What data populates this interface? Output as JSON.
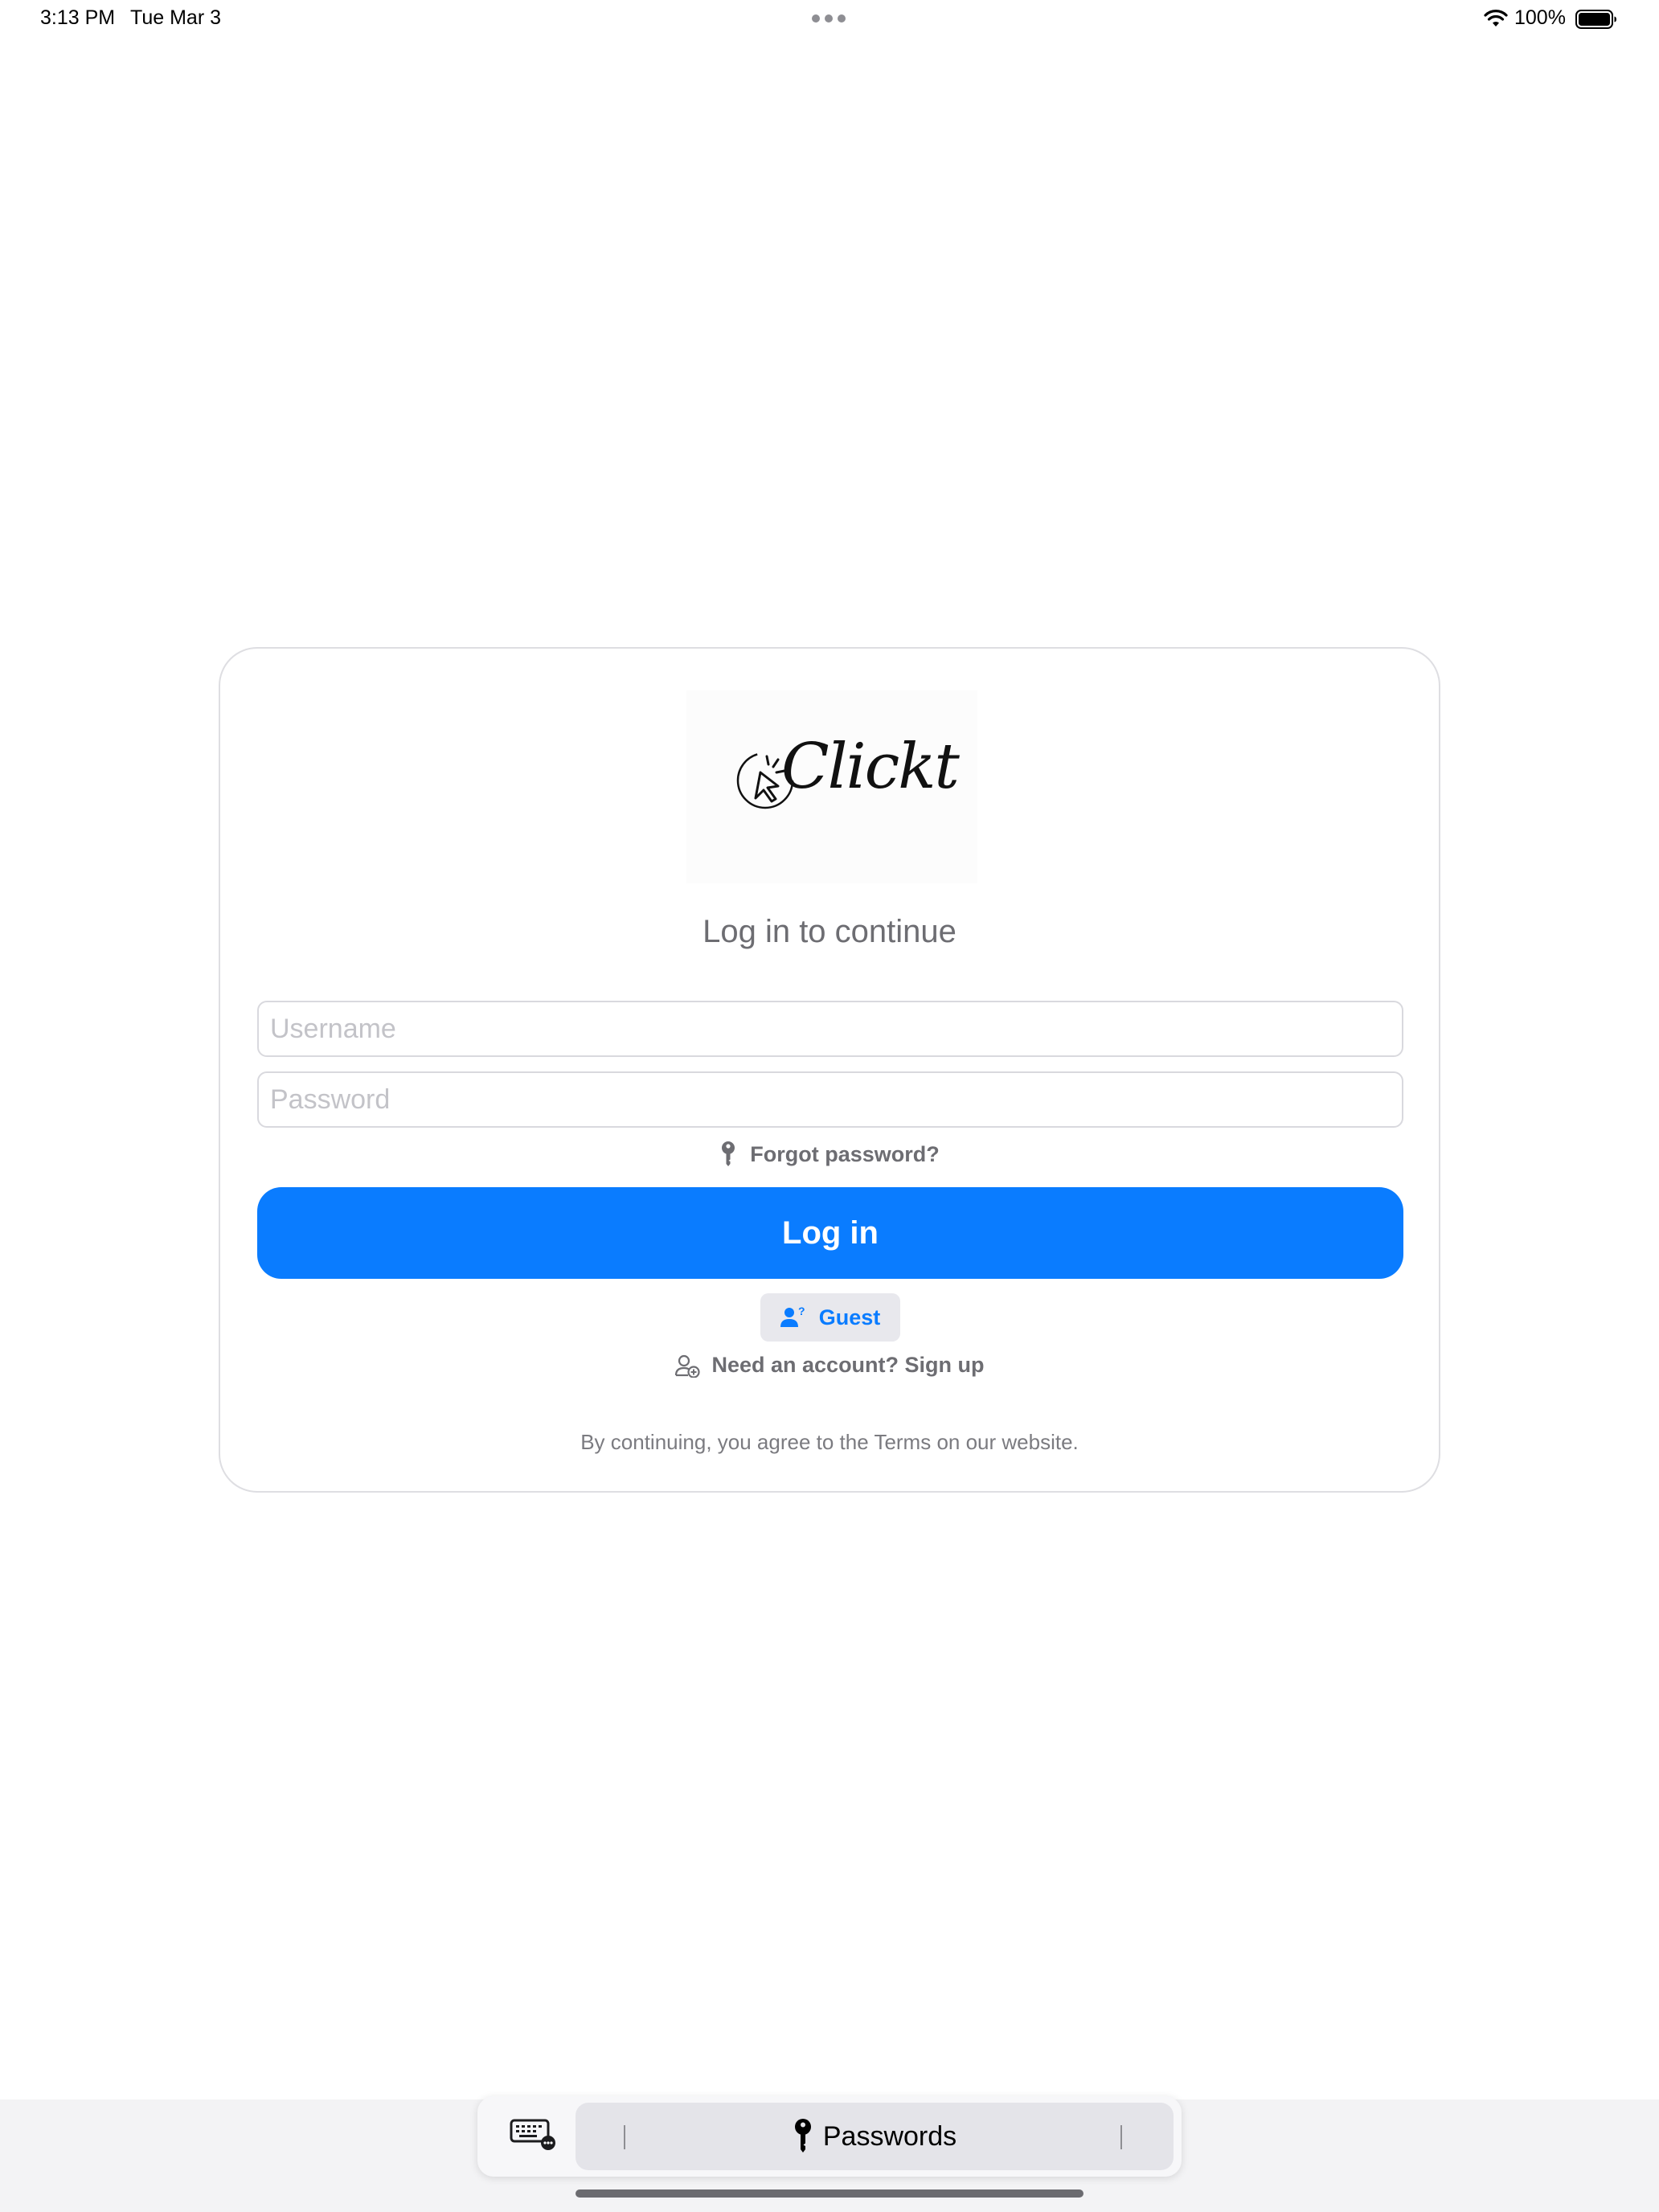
{
  "status_bar": {
    "time": "3:13 PM",
    "date": "Tue Mar 3",
    "battery": "100%"
  },
  "logo": {
    "text": "Clickt"
  },
  "login": {
    "subtitle": "Log in to continue",
    "username_placeholder": "Username",
    "password_placeholder": "Password",
    "forgot_label": "Forgot password?",
    "login_button": "Log in",
    "guest_label": "Guest",
    "signup_label": "Need an account? Sign up",
    "terms": "By continuing, you agree to the Terms on our website."
  },
  "keyboard_bar": {
    "passwords_label": "Passwords"
  },
  "colors": {
    "accent": "#0a7cff",
    "secondary_text": "#6d6d72",
    "guest_bg": "#e8e8ed"
  }
}
